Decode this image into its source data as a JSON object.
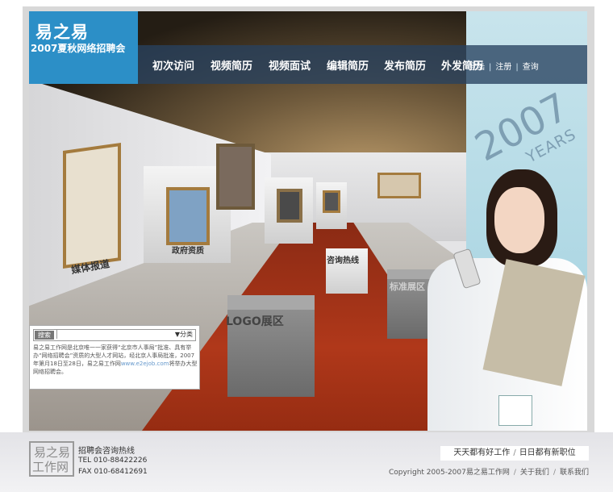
{
  "header": {
    "brand": "易之易",
    "tagline": "2007夏秋网络招聘会"
  },
  "nav": {
    "items": [
      "初次访问",
      "视频简历",
      "视频面试",
      "编辑简历",
      "发布简历",
      "外发简历"
    ]
  },
  "account": {
    "login": "登陆",
    "register": "注册",
    "query": "查询"
  },
  "years_banner": {
    "year": "2007",
    "years_text": "YEARS"
  },
  "exhibits": {
    "media_reports": "媒体报道",
    "government_info": "政府资质",
    "consult_hotline": "咨询热线",
    "logo_area": "LOGO展区",
    "standard_area": "标准展区"
  },
  "search": {
    "button": "搜索",
    "input_value": "",
    "category": "▼分类"
  },
  "intro": {
    "text1": "易之易工作网是北京唯一一家获得“北京市人事局”批准、具有举办“网络招聘会”资质的大型人才网站，经北京人事局批准，2007年第月18日至28日，易之易工作网",
    "domain": "www.e2ejob.com",
    "text2": "将举办大型网络招聘会。"
  },
  "footer": {
    "logo_line1": "易之易",
    "logo_line2": "工作网",
    "hotline_label": "招聘会咨询热线",
    "tel": "TEL  010-88422226",
    "fax": "FAX  010-68412691",
    "slogan1": "天天都有好工作",
    "slogan2": "日日都有新职位",
    "copyright": "Copyright 2005-2007易之易工作网",
    "about": "关于我们",
    "contact": "联系我们"
  },
  "colors": {
    "brand_blue": "#2c8fc7",
    "nav_bg": "#28415f",
    "carpet": "#b0381a"
  }
}
